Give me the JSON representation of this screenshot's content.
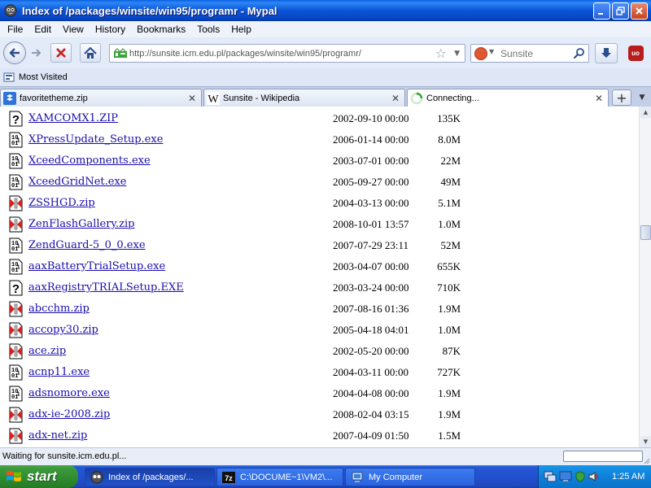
{
  "window": {
    "title": "Index of /packages/winsite/win95/programr - Mypal"
  },
  "menu": [
    "File",
    "Edit",
    "View",
    "History",
    "Bookmarks",
    "Tools",
    "Help"
  ],
  "navigation": {
    "url": "http://sunsite.icm.edu.pl/packages/winsite/win95/programr/",
    "search_engine": "Sunsite",
    "search_value": ""
  },
  "bookmarks": [
    {
      "label": "Most Visited",
      "icon": "most-visited-icon"
    }
  ],
  "tabs": [
    {
      "label": "favoritetheme.zip",
      "icon": "dropbox-icon",
      "active": false
    },
    {
      "label": "Sunsite - Wikipedia",
      "icon": "wikipedia-icon",
      "active": false
    },
    {
      "label": "Connecting...",
      "icon": "loading-icon",
      "active": true
    }
  ],
  "files": [
    {
      "name": "XAMCOMX1.ZIP",
      "date": "2002-09-10 00:00",
      "size": "135K",
      "icon": "unknown-file-icon"
    },
    {
      "name": "XPressUpdate_Setup.exe",
      "date": "2006-01-14 00:00",
      "size": "8.0M",
      "icon": "binary-file-icon"
    },
    {
      "name": "XceedComponents.exe",
      "date": "2003-07-01 00:00",
      "size": "22M",
      "icon": "binary-file-icon"
    },
    {
      "name": "XceedGridNet.exe",
      "date": "2005-09-27 00:00",
      "size": "49M",
      "icon": "binary-file-icon"
    },
    {
      "name": "ZSSHGD.zip",
      "date": "2004-03-13 00:00",
      "size": "5.1M",
      "icon": "compressed-file-icon"
    },
    {
      "name": "ZenFlashGallery.zip",
      "date": "2008-10-01 13:57",
      "size": "1.0M",
      "icon": "compressed-file-icon"
    },
    {
      "name": "ZendGuard-5_0_0.exe",
      "date": "2007-07-29 23:11",
      "size": "52M",
      "icon": "binary-file-icon"
    },
    {
      "name": "aaxBatteryTrialSetup.exe",
      "date": "2003-04-07 00:00",
      "size": "655K",
      "icon": "binary-file-icon"
    },
    {
      "name": "aaxRegistryTRIALSetup.EXE",
      "date": "2003-03-24 00:00",
      "size": "710K",
      "icon": "unknown-file-icon"
    },
    {
      "name": "abcchm.zip",
      "date": "2007-08-16 01:36",
      "size": "1.9M",
      "icon": "compressed-file-icon"
    },
    {
      "name": "accopy30.zip",
      "date": "2005-04-18 04:01",
      "size": "1.0M",
      "icon": "compressed-file-icon"
    },
    {
      "name": "ace.zip",
      "date": "2002-05-20 00:00",
      "size": "87K",
      "icon": "compressed-file-icon"
    },
    {
      "name": "acnp11.exe",
      "date": "2004-03-11 00:00",
      "size": "727K",
      "icon": "binary-file-icon"
    },
    {
      "name": "adsnomore.exe",
      "date": "2004-04-08 00:00",
      "size": "1.9M",
      "icon": "binary-file-icon"
    },
    {
      "name": "adx-ie-2008.zip",
      "date": "2008-02-04 03:15",
      "size": "1.9M",
      "icon": "compressed-file-icon"
    },
    {
      "name": "adx-net.zip",
      "date": "2007-04-09 01:50",
      "size": "1.5M",
      "icon": "compressed-file-icon"
    }
  ],
  "status": {
    "text": "Waiting for sunsite.icm.edu.pl..."
  },
  "taskbar": {
    "start_label": "start",
    "tasks": [
      {
        "label": "Index of /packages/...",
        "icon": "mypal-icon",
        "active": true
      },
      {
        "label": "C:\\DOCUME~1\\VM2\\...",
        "icon": "7zip-icon",
        "active": false
      },
      {
        "label": "My Computer",
        "icon": "my-computer-icon",
        "active": false
      }
    ],
    "clock": "1:25 AM"
  },
  "colors": {
    "titlebar": "#0b54d6",
    "link": "#1a0dab",
    "taskbar": "#2250ce",
    "start": "#2e8b2e",
    "tray": "#0f81da"
  }
}
